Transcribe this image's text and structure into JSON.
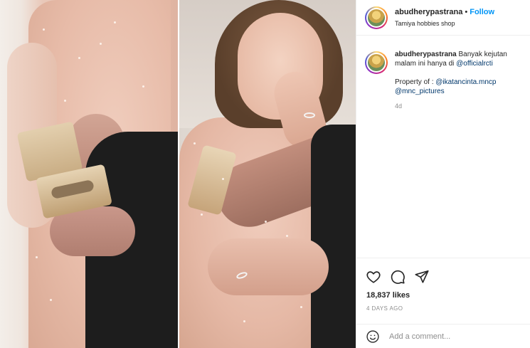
{
  "header": {
    "username": "abudherypastrana",
    "separator": "•",
    "follow_label": "Follow",
    "subtitle": "Tamiya hobbies shop"
  },
  "caption": {
    "username": "abudherypastrana",
    "text_1": "Banyak kejutan malam ini hanya di",
    "mention_1": "@officialrcti",
    "property_label": "Property of :",
    "mention_2": "@ikatancinta.mncp",
    "mention_3": "@mnc_pictures",
    "time_ago": "4d"
  },
  "actions": {
    "icons": [
      "heart-icon",
      "comment-icon",
      "share-icon"
    ],
    "likes": "18,837 likes",
    "date": "4 DAYS AGO"
  },
  "comment": {
    "placeholder": "Add a comment..."
  },
  "colors": {
    "follow": "#0095f6",
    "mention": "#00376b",
    "muted": "#8e8e8e",
    "text": "#262626",
    "border": "#efefef"
  }
}
